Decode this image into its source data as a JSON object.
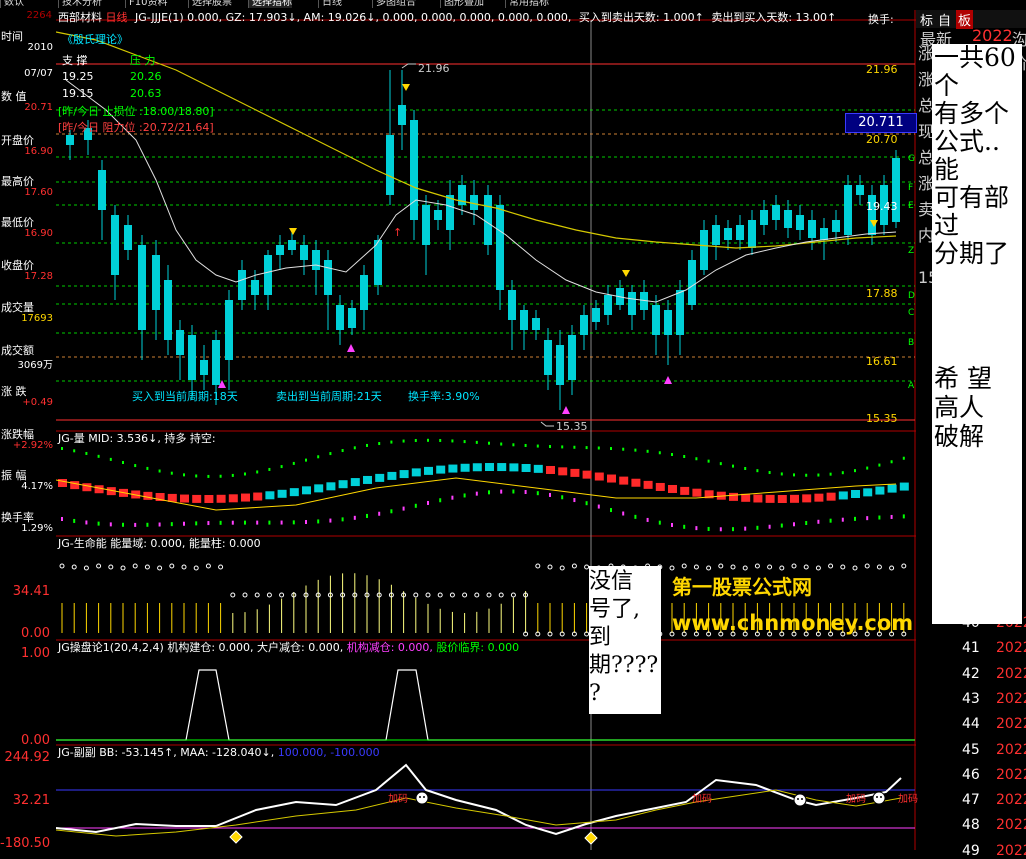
{
  "menubar": {
    "items": [
      "数认",
      "技术分析",
      "F10资料",
      "选择股票",
      "选择指标",
      "日线",
      "多图组合",
      "图形叠加",
      "常用指标"
    ],
    "title": "西部材料",
    "period": "日线",
    "formula_line": "JG-JJJE(1) 0.000, GZ: 17.903↓, AM: 19.026↓, 0.000, 0.000, 0.000, 0.000, 0.000,",
    "buy_days_label": "买入到卖出天数: 1.000↑",
    "sell_days_label": "卖出到买入天数: 13.00↑",
    "turnover_label": "换手:"
  },
  "left_panel": {
    "top_price": "2264",
    "rows": [
      {
        "label": "时间",
        "value": "2010",
        "color": "#ffffff"
      },
      {
        "label": "",
        "value": "07/07",
        "color": "#ffffff"
      },
      {
        "label": "数 值",
        "value": "20.71",
        "color": "#ff3030"
      },
      {
        "label": "开盘价",
        "value": "16.90",
        "color": "#ff3030"
      },
      {
        "label": "最高价",
        "value": "17.60",
        "color": "#ff3030"
      },
      {
        "label": "最低价",
        "value": "16.90",
        "color": "#ff3030"
      },
      {
        "label": "收盘价",
        "value": "17.28",
        "color": "#ff3030"
      },
      {
        "label": "成交量",
        "value": "17693",
        "color": "#ffd700"
      },
      {
        "label": "成交额",
        "value": "3069万",
        "color": "#ffffff"
      },
      {
        "label": "涨 跌",
        "value": "+0.49",
        "color": "#ff3030"
      },
      {
        "label": "涨跌幅",
        "value": "+2.92%",
        "color": "#ff3030"
      },
      {
        "label": "振 幅",
        "value": "4.17%",
        "color": "#ffffff"
      },
      {
        "label": "换手率",
        "value": "1.29%",
        "color": "#ffffff"
      }
    ],
    "axis_values": [
      "34.41",
      "0.00",
      "1.00",
      "0.00",
      "244.92",
      "32.21",
      "-180.50"
    ]
  },
  "main_chart": {
    "theory_title": "《殷氏理论》",
    "support_label": "支 撑",
    "pressure_label": "压 力",
    "support_values": [
      "19.25",
      "19.15"
    ],
    "pressure_values": [
      "20.26",
      "20.63"
    ],
    "stop_label": "[昨/今日 止损位 :18.00/18.80]",
    "resist_label": "[昨/今日 阻力位 :20.72/21.64]",
    "high_marker": "21.96",
    "low_marker": "15.35",
    "price_box": "20.711",
    "right_levels": [
      "21.96",
      "20.70",
      "19.43",
      "17.88",
      "16.61",
      "15.35"
    ],
    "level_letters": [
      "G",
      "F",
      "E",
      "Z",
      "D",
      "C",
      "B",
      "A"
    ],
    "buy_period_text": "买入到当前周期:18天",
    "sell_period_text": "卖出到当前周期:21天",
    "turnover_text": "换手率:3.90%"
  },
  "sub1": {
    "header": "JG-量 MID: 3.536↓, 持多  持空:"
  },
  "sub2": {
    "header": "JG-生命能 能量域: 0.000, 能量柱: 0.000"
  },
  "sub3": {
    "header_white": "JG操盘论1(20,4,2,4) 机构建仓: 0.000, 大户减仓: 0.000,",
    "header_magenta": "机构减仓: 0.000,",
    "header_green": "股价临界: 0.000"
  },
  "sub4": {
    "header_white": "JG-副副 BB: -53.145↑, MAA: -128.040↓,",
    "header_blue": "100.000, -100.000",
    "add_label": "加码"
  },
  "right_panel": {
    "header_tabs": [
      "标",
      "自",
      "板"
    ],
    "top_texts": [
      "最新",
      "2022",
      "沟价"
    ],
    "row_numbers": [
      "40",
      "41",
      "42",
      "43",
      "44",
      "45",
      "46",
      "47",
      "48",
      "49"
    ],
    "row_years": [
      "2022",
      "2022",
      "2022",
      "2022",
      "2022",
      "2022",
      "2022",
      "2022",
      "2022",
      "2022"
    ],
    "behind_chars": [
      "涨",
      "涨",
      "总",
      "现",
      "总",
      "涨",
      "卖",
      "内",
      "15"
    ]
  },
  "overlay_note": {
    "lines": [
      "一共60个",
      "有多个",
      "公式..能",
      "可有部过",
      "分期了"
    ],
    "wish_lines": [
      "希 望",
      "高人",
      "破解"
    ]
  },
  "expired_note": {
    "lines": [
      "没信",
      "号了,",
      "到",
      "期????",
      "?"
    ]
  },
  "watermark": {
    "name": "第一股票公式网",
    "url": "www.chnmoney.com"
  }
}
